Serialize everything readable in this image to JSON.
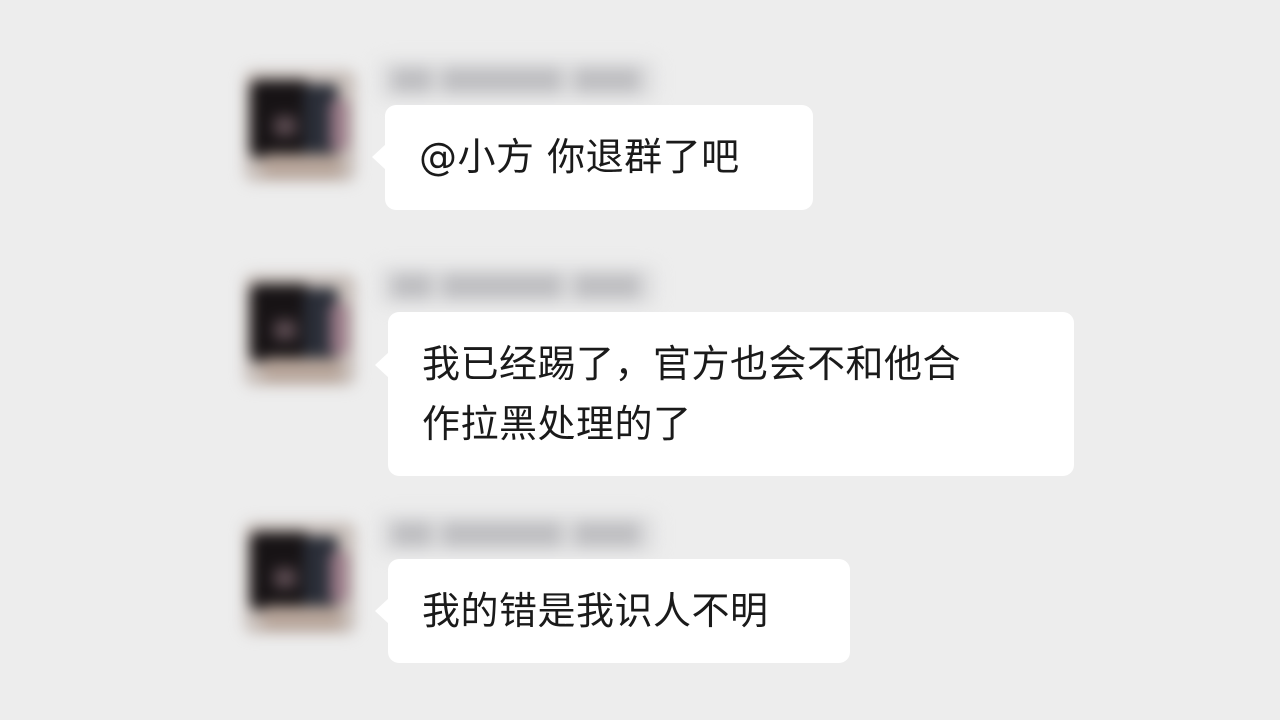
{
  "messages": [
    {
      "text": "@小方 你退群了吧"
    },
    {
      "text": "我已经踢了，官方也会不和他合\n作拉黑处理的了"
    },
    {
      "text": "我的错是我识人不明"
    }
  ]
}
